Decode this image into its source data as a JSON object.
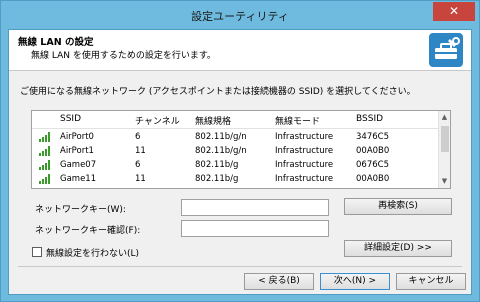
{
  "window": {
    "title": "設定ユーティリティ",
    "close_glyph": "✕"
  },
  "header": {
    "title": "無線 LAN の設定",
    "subtitle": "無線 LAN を使用するための設定を行います。",
    "icon": "toolbox-icon"
  },
  "instruction": "ご使用になる無線ネットワーク (アクセスポイントまたは接続機器の SSID) を選択してください。",
  "network_list": {
    "columns": [
      "SSID",
      "チャンネル",
      "無線規格",
      "無線モード",
      "BSSID"
    ],
    "rows": [
      [
        "AirPort0",
        "6",
        "802.11b/g/n",
        "Infrastructure",
        "3476C5"
      ],
      [
        "AirPort1",
        "11",
        "802.11b/g/n",
        "Infrastructure",
        "00A0B0"
      ],
      [
        "Game07",
        "6",
        "802.11b/g",
        "Infrastructure",
        "0676C5"
      ],
      [
        "Game11",
        "11",
        "802.11b/g",
        "Infrastructure",
        "00A0B0"
      ]
    ],
    "signal_icon": "signal-strength-icon",
    "signal_color": "#3a9a2a",
    "scroll_up_glyph": "▲",
    "scroll_down_glyph": "▼"
  },
  "form": {
    "network_key_label": "ネットワークキー(W):",
    "network_key_value": "",
    "network_key_confirm_label": "ネットワークキー確認(F):",
    "network_key_confirm_value": "",
    "rescan_button": "再検索(S)",
    "no_wireless_checkbox": "無線設定を行わない(L)",
    "no_wireless_checked": false,
    "advanced_button": "詳細設定(D) >>"
  },
  "footer": {
    "back_button": "< 戻る(B)",
    "next_button": "次へ(N) >",
    "cancel_button": "キャンセル"
  },
  "colors": {
    "title_bar": "#6fbbe0",
    "close_button": "#c7453d",
    "header_icon": "#2f86c5"
  }
}
